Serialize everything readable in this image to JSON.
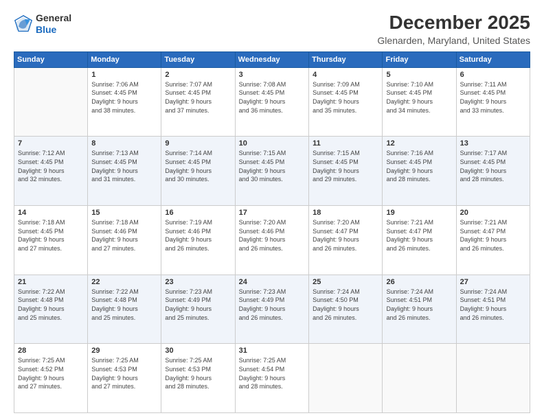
{
  "logo": {
    "general": "General",
    "blue": "Blue"
  },
  "header": {
    "title": "December 2025",
    "subtitle": "Glenarden, Maryland, United States"
  },
  "days_of_week": [
    "Sunday",
    "Monday",
    "Tuesday",
    "Wednesday",
    "Thursday",
    "Friday",
    "Saturday"
  ],
  "weeks": [
    [
      {
        "day": "",
        "info": ""
      },
      {
        "day": "1",
        "info": "Sunrise: 7:06 AM\nSunset: 4:45 PM\nDaylight: 9 hours\nand 38 minutes."
      },
      {
        "day": "2",
        "info": "Sunrise: 7:07 AM\nSunset: 4:45 PM\nDaylight: 9 hours\nand 37 minutes."
      },
      {
        "day": "3",
        "info": "Sunrise: 7:08 AM\nSunset: 4:45 PM\nDaylight: 9 hours\nand 36 minutes."
      },
      {
        "day": "4",
        "info": "Sunrise: 7:09 AM\nSunset: 4:45 PM\nDaylight: 9 hours\nand 35 minutes."
      },
      {
        "day": "5",
        "info": "Sunrise: 7:10 AM\nSunset: 4:45 PM\nDaylight: 9 hours\nand 34 minutes."
      },
      {
        "day": "6",
        "info": "Sunrise: 7:11 AM\nSunset: 4:45 PM\nDaylight: 9 hours\nand 33 minutes."
      }
    ],
    [
      {
        "day": "7",
        "info": "Sunrise: 7:12 AM\nSunset: 4:45 PM\nDaylight: 9 hours\nand 32 minutes."
      },
      {
        "day": "8",
        "info": "Sunrise: 7:13 AM\nSunset: 4:45 PM\nDaylight: 9 hours\nand 31 minutes."
      },
      {
        "day": "9",
        "info": "Sunrise: 7:14 AM\nSunset: 4:45 PM\nDaylight: 9 hours\nand 30 minutes."
      },
      {
        "day": "10",
        "info": "Sunrise: 7:15 AM\nSunset: 4:45 PM\nDaylight: 9 hours\nand 30 minutes."
      },
      {
        "day": "11",
        "info": "Sunrise: 7:15 AM\nSunset: 4:45 PM\nDaylight: 9 hours\nand 29 minutes."
      },
      {
        "day": "12",
        "info": "Sunrise: 7:16 AM\nSunset: 4:45 PM\nDaylight: 9 hours\nand 28 minutes."
      },
      {
        "day": "13",
        "info": "Sunrise: 7:17 AM\nSunset: 4:45 PM\nDaylight: 9 hours\nand 28 minutes."
      }
    ],
    [
      {
        "day": "14",
        "info": "Sunrise: 7:18 AM\nSunset: 4:45 PM\nDaylight: 9 hours\nand 27 minutes."
      },
      {
        "day": "15",
        "info": "Sunrise: 7:18 AM\nSunset: 4:46 PM\nDaylight: 9 hours\nand 27 minutes."
      },
      {
        "day": "16",
        "info": "Sunrise: 7:19 AM\nSunset: 4:46 PM\nDaylight: 9 hours\nand 26 minutes."
      },
      {
        "day": "17",
        "info": "Sunrise: 7:20 AM\nSunset: 4:46 PM\nDaylight: 9 hours\nand 26 minutes."
      },
      {
        "day": "18",
        "info": "Sunrise: 7:20 AM\nSunset: 4:47 PM\nDaylight: 9 hours\nand 26 minutes."
      },
      {
        "day": "19",
        "info": "Sunrise: 7:21 AM\nSunset: 4:47 PM\nDaylight: 9 hours\nand 26 minutes."
      },
      {
        "day": "20",
        "info": "Sunrise: 7:21 AM\nSunset: 4:47 PM\nDaylight: 9 hours\nand 26 minutes."
      }
    ],
    [
      {
        "day": "21",
        "info": "Sunrise: 7:22 AM\nSunset: 4:48 PM\nDaylight: 9 hours\nand 25 minutes."
      },
      {
        "day": "22",
        "info": "Sunrise: 7:22 AM\nSunset: 4:48 PM\nDaylight: 9 hours\nand 25 minutes."
      },
      {
        "day": "23",
        "info": "Sunrise: 7:23 AM\nSunset: 4:49 PM\nDaylight: 9 hours\nand 25 minutes."
      },
      {
        "day": "24",
        "info": "Sunrise: 7:23 AM\nSunset: 4:49 PM\nDaylight: 9 hours\nand 26 minutes."
      },
      {
        "day": "25",
        "info": "Sunrise: 7:24 AM\nSunset: 4:50 PM\nDaylight: 9 hours\nand 26 minutes."
      },
      {
        "day": "26",
        "info": "Sunrise: 7:24 AM\nSunset: 4:51 PM\nDaylight: 9 hours\nand 26 minutes."
      },
      {
        "day": "27",
        "info": "Sunrise: 7:24 AM\nSunset: 4:51 PM\nDaylight: 9 hours\nand 26 minutes."
      }
    ],
    [
      {
        "day": "28",
        "info": "Sunrise: 7:25 AM\nSunset: 4:52 PM\nDaylight: 9 hours\nand 27 minutes."
      },
      {
        "day": "29",
        "info": "Sunrise: 7:25 AM\nSunset: 4:53 PM\nDaylight: 9 hours\nand 27 minutes."
      },
      {
        "day": "30",
        "info": "Sunrise: 7:25 AM\nSunset: 4:53 PM\nDaylight: 9 hours\nand 28 minutes."
      },
      {
        "day": "31",
        "info": "Sunrise: 7:25 AM\nSunset: 4:54 PM\nDaylight: 9 hours\nand 28 minutes."
      },
      {
        "day": "",
        "info": ""
      },
      {
        "day": "",
        "info": ""
      },
      {
        "day": "",
        "info": ""
      }
    ]
  ]
}
